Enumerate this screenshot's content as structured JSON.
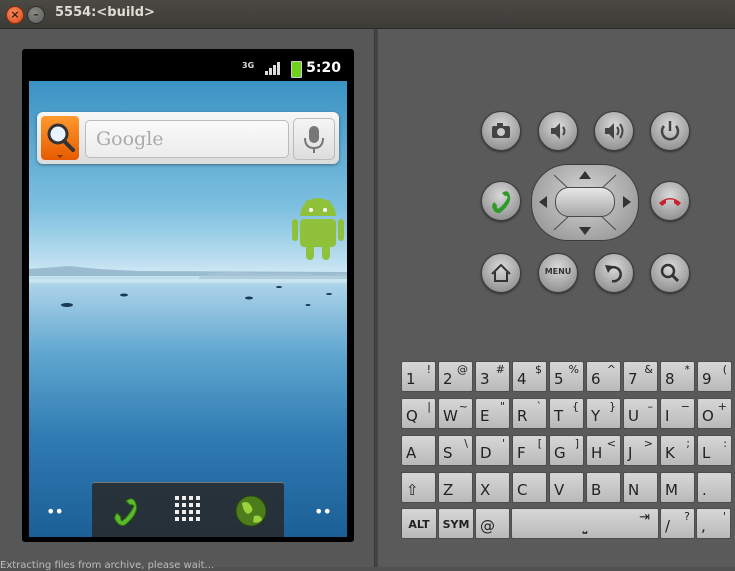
{
  "window": {
    "title": "5554:<build>",
    "close_glyph": "×",
    "minimize_glyph": "–"
  },
  "statusbar": {
    "network": "3G",
    "time": "5:20"
  },
  "search_widget": {
    "placeholder": "Google"
  },
  "footer_text": "Extracting files from archive, please wait...",
  "controls": {
    "row1": [
      {
        "name": "camera-button",
        "icon": "camera-icon"
      },
      {
        "name": "volume-down-button",
        "icon": "volume-down-icon"
      },
      {
        "name": "volume-up-button",
        "icon": "volume-up-icon"
      },
      {
        "name": "power-button",
        "icon": "power-icon"
      }
    ],
    "row3": [
      {
        "name": "home-button",
        "icon": "home-icon"
      },
      {
        "name": "menu-button",
        "label": "MENU"
      },
      {
        "name": "back-button",
        "icon": "back-icon"
      },
      {
        "name": "search-button",
        "icon": "search-icon"
      }
    ]
  },
  "keyboard": {
    "rows": [
      [
        {
          "m": "1",
          "a": "!"
        },
        {
          "m": "2",
          "a": "@"
        },
        {
          "m": "3",
          "a": "#"
        },
        {
          "m": "4",
          "a": "$"
        },
        {
          "m": "5",
          "a": "%"
        },
        {
          "m": "6",
          "a": "^"
        },
        {
          "m": "7",
          "a": "&"
        },
        {
          "m": "8",
          "a": "*"
        },
        {
          "m": "9",
          "a": "("
        }
      ],
      [
        {
          "m": "Q",
          "a": "|"
        },
        {
          "m": "W",
          "a": "~"
        },
        {
          "m": "E",
          "a": "\""
        },
        {
          "m": "R",
          "a": "`"
        },
        {
          "m": "T",
          "a": "{"
        },
        {
          "m": "Y",
          "a": "}"
        },
        {
          "m": "U",
          "a": "–"
        },
        {
          "m": "I",
          "a": "−"
        },
        {
          "m": "O",
          "a": "+"
        }
      ],
      [
        {
          "m": "A",
          "a": ""
        },
        {
          "m": "S",
          "a": "\\"
        },
        {
          "m": "D",
          "a": "'"
        },
        {
          "m": "F",
          "a": "["
        },
        {
          "m": "G",
          "a": "]"
        },
        {
          "m": "H",
          "a": "<"
        },
        {
          "m": "J",
          "a": ">"
        },
        {
          "m": "K",
          "a": ";"
        },
        {
          "m": "L",
          "a": ":"
        }
      ],
      [
        {
          "m": "⇧",
          "a": ""
        },
        {
          "m": "Z",
          "a": ""
        },
        {
          "m": "X",
          "a": ""
        },
        {
          "m": "C",
          "a": ""
        },
        {
          "m": "V",
          "a": ""
        },
        {
          "m": "B",
          "a": ""
        },
        {
          "m": "N",
          "a": ""
        },
        {
          "m": "M",
          "a": ""
        },
        {
          "m": ".",
          "a": ""
        }
      ]
    ],
    "bottom": {
      "alt": "ALT",
      "sym": "SYM",
      "at": "@",
      "space": "⎵",
      "tab": "⇥",
      "slash": "/",
      "question": "?",
      "comma": ",",
      "quote": "'"
    }
  },
  "colors": {
    "accent": "#ff8a1c",
    "titlebar": "#3c3b37",
    "android_green": "#8fc23a"
  }
}
